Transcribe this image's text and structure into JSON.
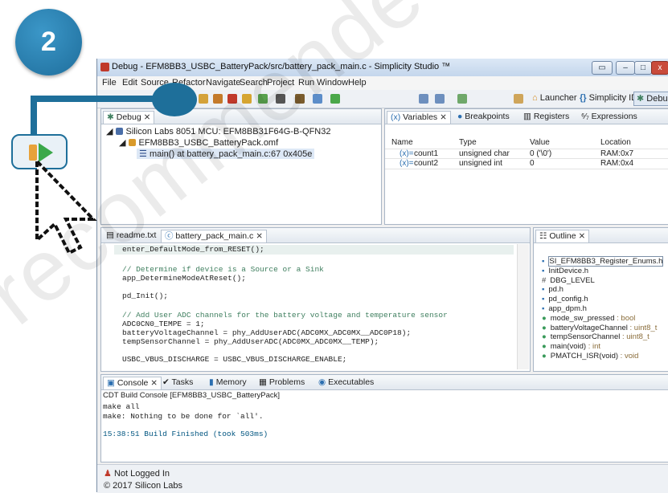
{
  "step_badge": "2",
  "watermark": "recommended fo",
  "window": {
    "title": "Debug - EFM8BB3_USBC_BatteryPack/src/battery_pack_main.c - Simplicity Studio ™"
  },
  "menu": [
    "File",
    "Edit",
    "Source",
    "Refactor",
    "Navigate",
    "Search",
    "Project",
    "Run",
    "Window",
    "Help"
  ],
  "perspectives": {
    "launcher": "Launcher",
    "ide": "Simplicity IDE",
    "debug": "Debug"
  },
  "debug_view": {
    "tab": "Debug",
    "tree": [
      "Silicon Labs 8051 MCU: EFM8BB31F64G-B-QFN32",
      "EFM8BB3_USBC_BatteryPack.omf",
      "main() at battery_pack_main.c:67 0x405e"
    ]
  },
  "variables_view": {
    "tabs": [
      "Variables",
      "Breakpoints",
      "Registers",
      "Expressions"
    ],
    "columns": [
      "Name",
      "Type",
      "Value",
      "Location"
    ],
    "rows": [
      {
        "name": "count1",
        "type": "unsigned char",
        "value": "0 ('\\0')",
        "location": "RAM:0x7"
      },
      {
        "name": "count2",
        "type": "unsigned int",
        "value": "0",
        "location": "RAM:0x4"
      }
    ]
  },
  "editor": {
    "tabs": [
      "readme.txt",
      "battery_pack_main.c"
    ],
    "lines": [
      "enter_DefaultMode_from_RESET();",
      "",
      "// Determine if device is a Source or a Sink",
      "app_DetermineModeAtReset();",
      "",
      "pd_Init();",
      "",
      "// Add User ADC channels for the battery voltage and temperature sensor",
      "ADC0CN0_TEMPE = 1;",
      "batteryVoltageChannel = phy_AddUserADC(ADC0MX_ADC0MX__ADC0P18);",
      "tempSensorChannel = phy_AddUserADC(ADC0MX_ADC0MX__TEMP);",
      "",
      "USBC_VBUS_DISCHARGE = USBC_VBUS_DISCHARGE_ENABLE;"
    ]
  },
  "outline": {
    "tab": "Outline",
    "items": [
      {
        "label": "SI_EFM8BB3_Register_Enums.h",
        "suffix": "",
        "kind": "include"
      },
      {
        "label": "InitDevice.h",
        "suffix": "",
        "kind": "include"
      },
      {
        "label": "DBG_LEVEL",
        "suffix": "",
        "kind": "macro"
      },
      {
        "label": "pd.h",
        "suffix": "",
        "kind": "include"
      },
      {
        "label": "pd_config.h",
        "suffix": "",
        "kind": "include"
      },
      {
        "label": "app_dpm.h",
        "suffix": "",
        "kind": "include"
      },
      {
        "label": "mode_sw_pressed",
        "suffix": " : bool",
        "kind": "var"
      },
      {
        "label": "batteryVoltageChannel",
        "suffix": " : uint8_t",
        "kind": "var"
      },
      {
        "label": "tempSensorChannel",
        "suffix": " : uint8_t",
        "kind": "var"
      },
      {
        "label": "main(void)",
        "suffix": " : int",
        "kind": "func"
      },
      {
        "label": "PMATCH_ISR(void)",
        "suffix": " : void",
        "kind": "func"
      }
    ]
  },
  "console": {
    "tabs": [
      "Console",
      "Tasks",
      "Memory",
      "Problems",
      "Executables"
    ],
    "header": "CDT Build Console [EFM8BB3_USBC_BatteryPack]",
    "lines": [
      "make all",
      "make: Nothing to be done for `all'.",
      "",
      "15:38:51 Build Finished (took 503ms)"
    ]
  },
  "status": {
    "login": "Not Logged In",
    "copyright": "© 2017 Silicon Labs"
  },
  "colors": {
    "badge": "#2a7fb0",
    "callout": "#1e6f9a",
    "resume_green": "#3aa84a",
    "resume_orange": "#e8a23a"
  }
}
